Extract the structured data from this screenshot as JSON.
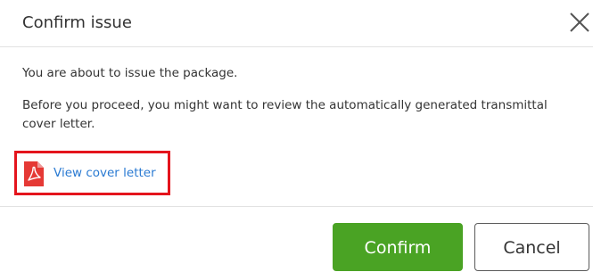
{
  "dialog": {
    "title": "Confirm issue",
    "close_icon": "close-icon",
    "message_1": "You are about to issue the package.",
    "message_2": "Before you proceed, you might want to review the automatically generated transmittal cover letter.",
    "link_icon": "pdf-file-icon",
    "link_label": "View cover letter",
    "confirm_label": "Confirm",
    "cancel_label": "Cancel"
  },
  "colors": {
    "confirm_button": "#4aa324",
    "link": "#2a7ad2",
    "highlight_border": "#e4141c",
    "pdf_icon": "#e53935"
  }
}
